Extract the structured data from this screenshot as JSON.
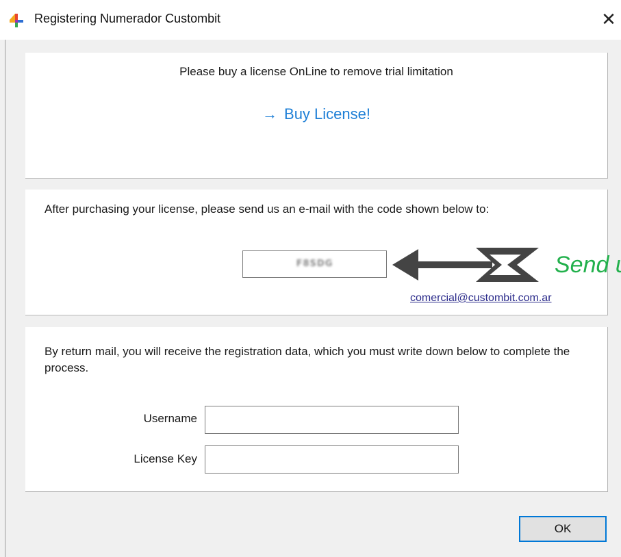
{
  "window": {
    "title": "Registering Numerador Custombit",
    "close_glyph": "✕"
  },
  "panel_buy": {
    "prompt": "Please buy a license OnLine to remove trial limitation",
    "link_arrow": "→",
    "link_label": "Buy License!"
  },
  "panel_code": {
    "instructions": "After purchasing your license, please send us an e-mail with the code shown below to:",
    "code": "F8SDG",
    "email": "comercial@custombit.com.ar"
  },
  "panel_register": {
    "instructions": "By return mail, you will receive the registration data, which you must write down below to complete the process.",
    "username_label": "Username",
    "username_value": "",
    "license_key_label": "License Key",
    "license_key_value": ""
  },
  "footer": {
    "ok_label": "OK"
  },
  "annotation": {
    "text": "Send u",
    "text_color": "#21b04b",
    "arrow_color": "#444444"
  },
  "colors": {
    "link": "#1e7fd6",
    "focus_border": "#0078d7"
  },
  "icons": {
    "app": "app-logo-icon",
    "close": "close-icon",
    "link_arrow": "arrow-right-icon"
  }
}
